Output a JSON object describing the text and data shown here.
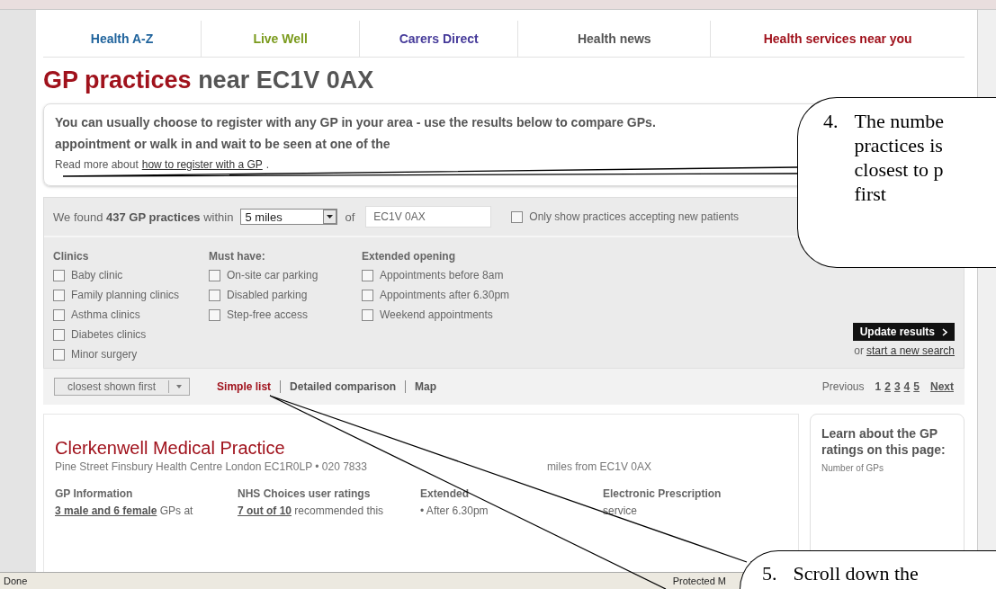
{
  "nav": [
    {
      "label": "Health A-Z",
      "color": "#1f639c"
    },
    {
      "label": "Live Well",
      "color": "#7a9a1c"
    },
    {
      "label": "Carers Direct",
      "color": "#463b9a"
    },
    {
      "label": "Health news",
      "color": "#555555"
    },
    {
      "label": "Health services near you",
      "color": "#a0121c"
    }
  ],
  "heading": {
    "highlight": "GP practices",
    "rest": "near EC1V 0AX"
  },
  "intro": {
    "lines": [
      "You can usually choose to register with any GP in your area - use the results below to compare GPs.",
      "appointment or walk in and wait to be seen at one of the"
    ],
    "read_more": "Read more about",
    "link": "how to register with a GP",
    "end": "."
  },
  "search": {
    "prefix": "We found",
    "count": "437 GP practices",
    "within": "within",
    "distance": "5 miles",
    "of": "of",
    "postcode": "EC1V 0AX",
    "new_patients": {
      "label": "Only show practices accepting new patients",
      "checked": false
    }
  },
  "filters": [
    {
      "title": "Clinics",
      "options": [
        {
          "label": "Baby clinic",
          "checked": false
        },
        {
          "label": "Family planning clinics",
          "checked": false
        },
        {
          "label": "Asthma clinics",
          "checked": false
        },
        {
          "label": "Diabetes clinics",
          "checked": false
        },
        {
          "label": "Minor surgery",
          "checked": false
        }
      ]
    },
    {
      "title": "Must have:",
      "options": [
        {
          "label": "On-site car parking",
          "checked": false
        },
        {
          "label": "Disabled parking",
          "checked": false
        },
        {
          "label": "Step-free access",
          "checked": false
        }
      ]
    },
    {
      "title": "Extended opening",
      "options": [
        {
          "label": "Appointments before 8am",
          "checked": false
        },
        {
          "label": "Appointments after 6.30pm",
          "checked": false
        },
        {
          "label": "Weekend appointments",
          "checked": false
        }
      ]
    }
  ],
  "update_button": "Update results",
  "restart": {
    "prefix": "or",
    "link": "start a new search"
  },
  "sort": {
    "value": "closest shown first"
  },
  "views": [
    {
      "label": "Simple list",
      "selected": true
    },
    {
      "label": "Detailed comparison",
      "selected": false
    },
    {
      "label": "Map",
      "selected": false
    }
  ],
  "pagination": {
    "previous": "Previous",
    "pages": [
      {
        "label": "1",
        "selected": true
      },
      {
        "label": "2",
        "selected": false
      },
      {
        "label": "3",
        "selected": false
      },
      {
        "label": "4",
        "selected": false
      },
      {
        "label": "5",
        "selected": false
      }
    ],
    "next": "Next"
  },
  "result": {
    "name": "Clerkenwell Medical Practice",
    "address": "Pine Street Finsbury Health Centre London EC1R0LP • 020 7833",
    "distance": "miles from EC1V 0AX",
    "columns": [
      {
        "heading": "GP Information",
        "line": "**3 male and 6 female** GPs at"
      },
      {
        "heading": "NHS Choices user ratings",
        "line": "**7 out of 10** recommended this"
      },
      {
        "heading": "Extended",
        "line": "• After 6.30pm"
      },
      {
        "heading": "Electronic Prescription",
        "line": "service"
      }
    ]
  },
  "sidebar": {
    "title": "Learn about the GP ratings on this page:",
    "subtitle": "Number of GPs"
  },
  "status_bar": {
    "left": "Done",
    "right": "Protected M"
  },
  "callouts": [
    {
      "number": "4.",
      "lines": [
        "The numbe",
        "practices is",
        "closest to p",
        "first"
      ]
    },
    {
      "number": "5.",
      "lines": [
        "Scroll down the"
      ]
    }
  ]
}
